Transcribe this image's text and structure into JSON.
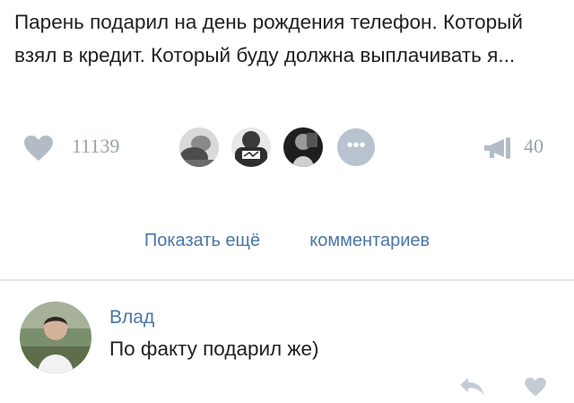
{
  "post": {
    "text": "Парень подарил на день рождения телефон. Который взял в кредит. Который буду должна выплачивать я..."
  },
  "stats": {
    "likes": "11139",
    "shares": "40",
    "more_icon": "ellipsis-icon"
  },
  "comments": {
    "show_more_prefix": "Показать ещё",
    "show_more_suffix": "комментариев"
  },
  "comment": {
    "author": "Влад",
    "text": "По факту подарил же)"
  },
  "colors": {
    "link": "#4a76a8",
    "muted": "#9aa3ad",
    "text": "#1f1f1f",
    "divider": "#e3e6ea"
  }
}
